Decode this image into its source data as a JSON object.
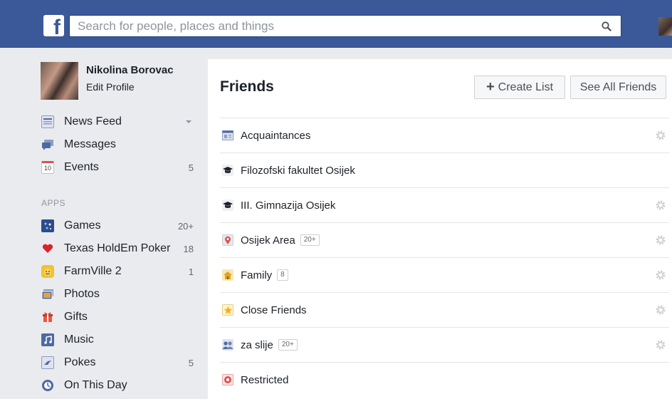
{
  "topbar": {
    "logo": "f",
    "search_placeholder": "Search for people, places and things",
    "search_icon": "search-icon",
    "brand_color": "#3b5998"
  },
  "sidebar": {
    "profile": {
      "name": "Nikolina Borovac",
      "edit_label": "Edit Profile"
    },
    "favorites": [
      {
        "label": "News Feed",
        "icon": "news-feed-icon",
        "count": ""
      },
      {
        "label": "Messages",
        "icon": "messages-icon",
        "count": ""
      },
      {
        "label": "Events",
        "icon": "events-icon",
        "icon_text": "10",
        "count": "5"
      }
    ],
    "apps_header": "APPS",
    "apps": [
      {
        "label": "Games",
        "icon": "games-icon",
        "count": "20+"
      },
      {
        "label": "Texas HoldEm Poker",
        "icon": "heart-icon",
        "count": "18"
      },
      {
        "label": "FarmVille 2",
        "icon": "farmville-icon",
        "count": "1"
      },
      {
        "label": "Photos",
        "icon": "photos-icon",
        "count": ""
      },
      {
        "label": "Gifts",
        "icon": "gift-icon",
        "count": ""
      },
      {
        "label": "Music",
        "icon": "music-icon",
        "count": ""
      },
      {
        "label": "Pokes",
        "icon": "pokes-icon",
        "count": "5"
      },
      {
        "label": "On This Day",
        "icon": "on-this-day-icon",
        "count": ""
      }
    ]
  },
  "main": {
    "title": "Friends",
    "create_list_label": "Create List",
    "see_all_label": "See All Friends",
    "lists": [
      {
        "label": "Acquaintances",
        "icon": "acquaintances-icon",
        "badge": ""
      },
      {
        "label": "Filozofski fakultet Osijek",
        "icon": "graduation-cap-icon",
        "badge": ""
      },
      {
        "label": "III. Gimnazija Osijek",
        "icon": "graduation-cap-icon",
        "badge": ""
      },
      {
        "label": "Osijek Area",
        "icon": "location-pin-icon",
        "badge": "20+"
      },
      {
        "label": "Family",
        "icon": "house-icon",
        "badge": "8"
      },
      {
        "label": "Close Friends",
        "icon": "star-icon",
        "badge": ""
      },
      {
        "label": "za slije",
        "icon": "people-icon",
        "badge": "20+"
      },
      {
        "label": "Restricted",
        "icon": "restricted-icon",
        "badge": ""
      }
    ]
  }
}
